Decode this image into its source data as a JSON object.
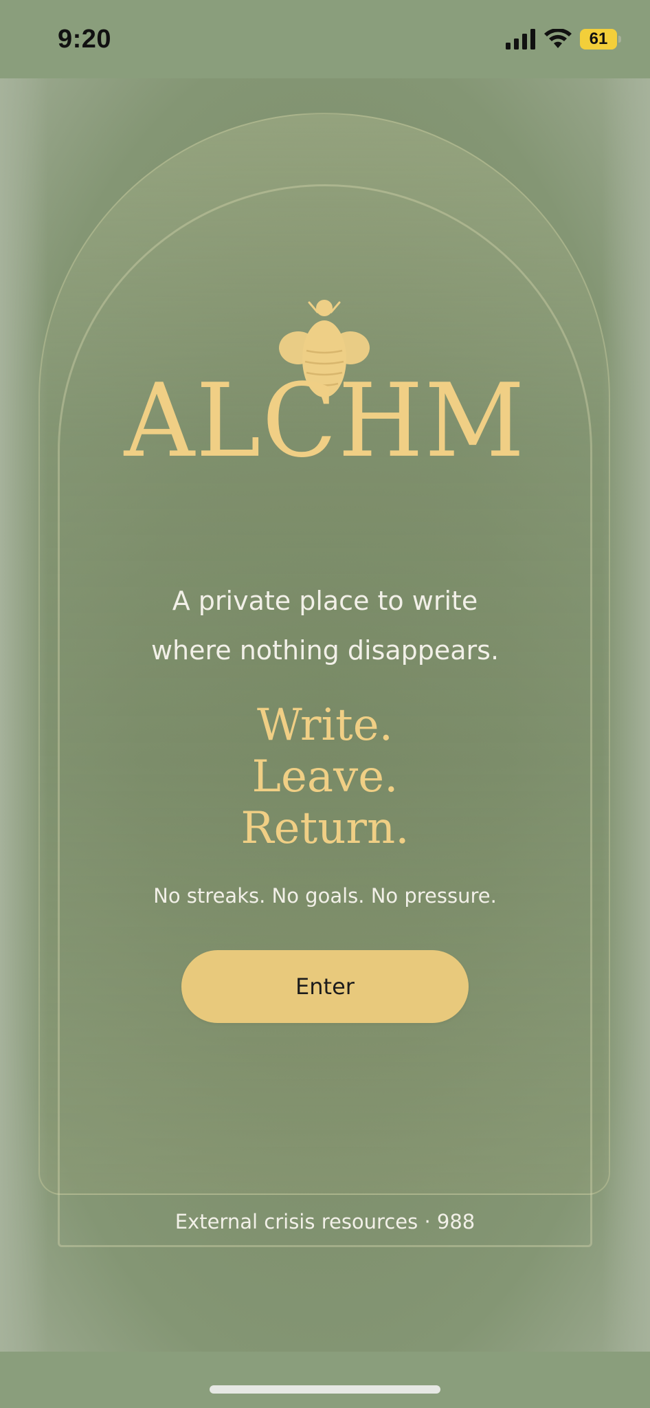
{
  "status_bar": {
    "time": "9:20",
    "battery": "61",
    "icons": [
      "cellular-signal-icon",
      "wifi-icon",
      "battery-icon"
    ]
  },
  "brand": {
    "logo_icon": "bee-icon",
    "title": "ALCHM"
  },
  "tagline": {
    "line1": "A private place to write",
    "line2": "where nothing disappears."
  },
  "mantra": {
    "line1": "Write.",
    "line2": "Leave.",
    "line3": "Return."
  },
  "subnote": "No streaks. No goals. No pressure.",
  "enter_button": {
    "label": "Enter"
  },
  "crisis_link": "External crisis resources · 988",
  "colors": {
    "background": "#7d8e6b",
    "accent_gold": "#f0cf85",
    "button_fill": "#e8c97c",
    "text_light": "#f2f0e8",
    "battery_yellow": "#f3cf3a"
  }
}
